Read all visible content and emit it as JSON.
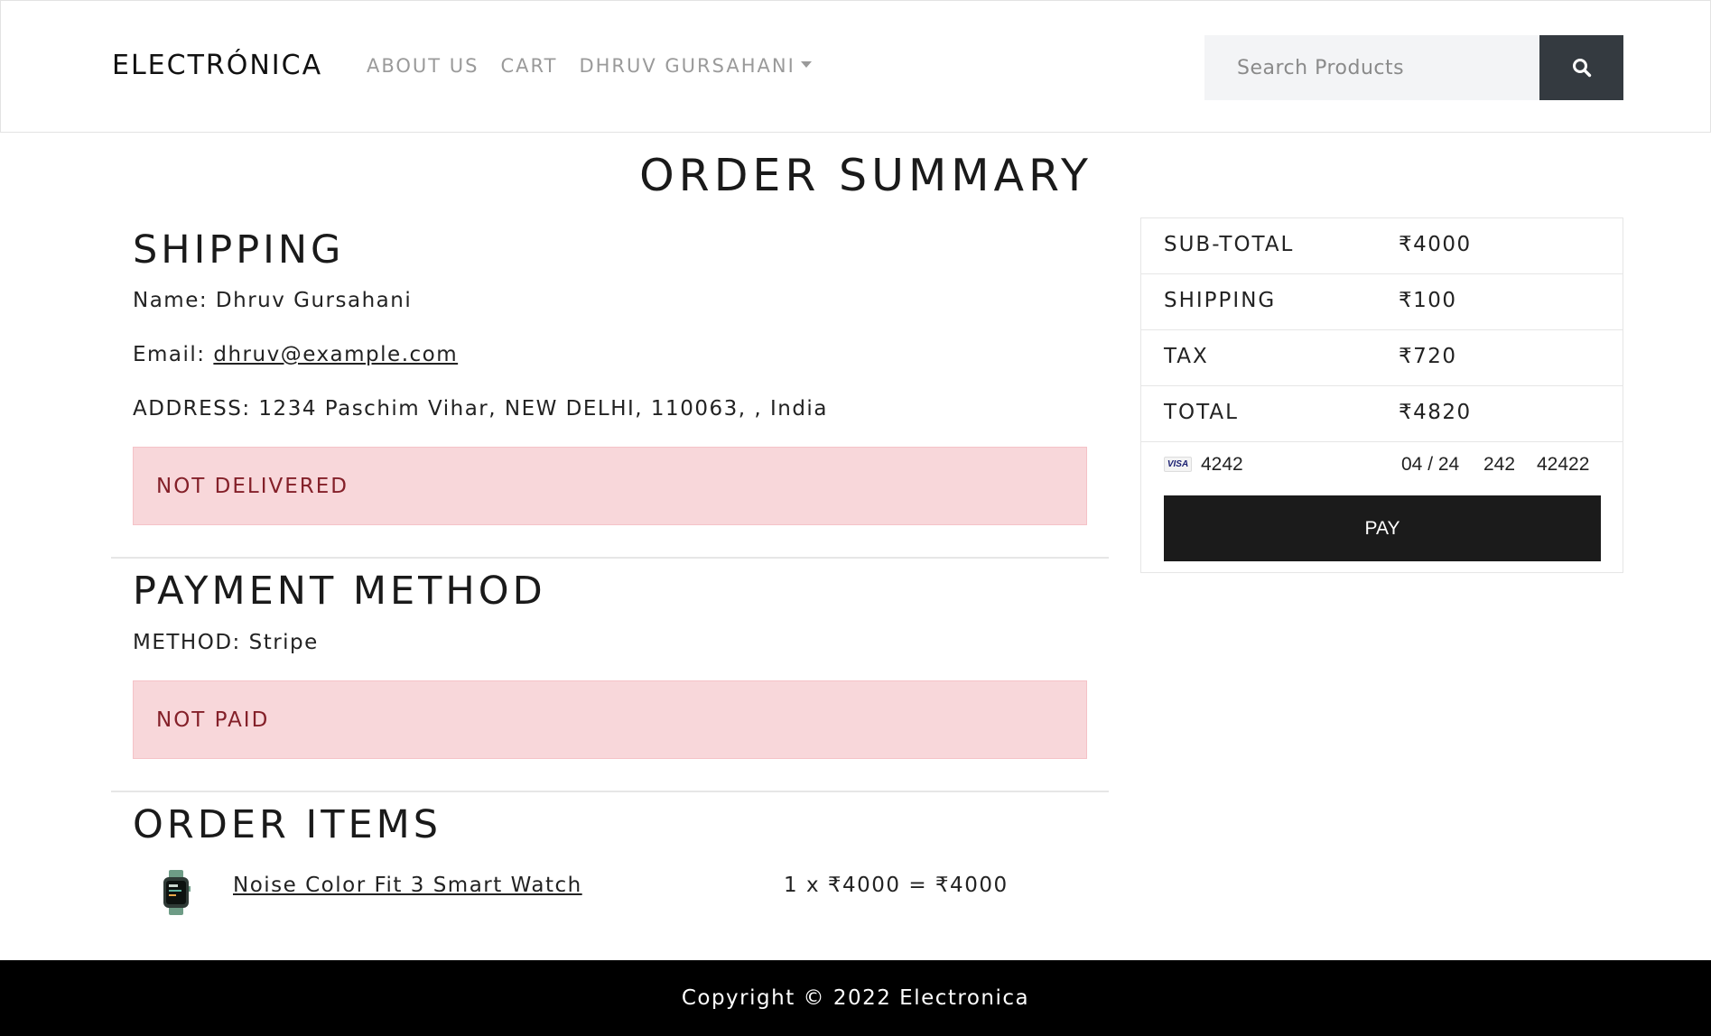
{
  "navbar": {
    "brand": "ELECTRÓNICA",
    "links": [
      "ABOUT US",
      "CART"
    ],
    "user_menu": "DHRUV GURSAHANI",
    "search_placeholder": "Search Products"
  },
  "page_title": "ORDER SUMMARY",
  "shipping": {
    "title": "SHIPPING",
    "name": "Name: Dhruv Gursahani",
    "email_label": "Email: ",
    "email": "dhruv@example.com",
    "address": "ADDRESS: 1234 Paschim Vihar, NEW DELHI, 110063, , India",
    "status": "NOT DELIVERED"
  },
  "payment": {
    "title": "PAYMENT METHOD",
    "method": "METHOD: Stripe",
    "status": "NOT PAID"
  },
  "order_items": {
    "title": "ORDER ITEMS",
    "items": [
      {
        "name": "Noise Color Fit 3 Smart Watch",
        "calc": "1 x ₹4000 = ₹4000"
      }
    ]
  },
  "summary": {
    "rows": [
      {
        "label": "SUB-TOTAL",
        "value": "₹4000"
      },
      {
        "label": "SHIPPING",
        "value": "₹100"
      },
      {
        "label": "TAX",
        "value": "₹720"
      },
      {
        "label": "TOTAL",
        "value": "₹4820"
      }
    ],
    "card": {
      "brand_text": "VISA",
      "number": "4242",
      "expiry": "04 / 24",
      "cvc": "242",
      "zip": "42422"
    },
    "pay_label": "PAY"
  },
  "footer": {
    "text": "Copyright © 2022 Electronica"
  },
  "colors": {
    "alert_bg": "#f8d7da",
    "alert_text": "#842029",
    "search_button": "#343a40",
    "pay_button": "#1b1b1b",
    "footer_bg": "#000000"
  }
}
